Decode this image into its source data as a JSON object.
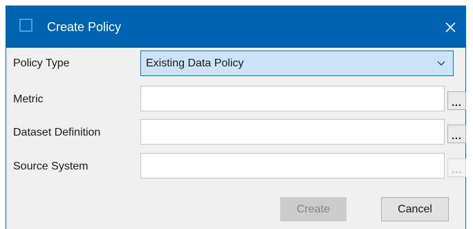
{
  "dialog": {
    "title": "Create Policy",
    "close_icon": "close-icon",
    "accent_color": "#0063b1"
  },
  "form": {
    "policy_type": {
      "label": "Policy Type",
      "value": "Existing Data Policy",
      "icon": "chevron-down-icon"
    },
    "metric": {
      "label": "Metric",
      "value": "",
      "browse_label": "..."
    },
    "dataset_definition": {
      "label": "Dataset Definition",
      "value": "",
      "browse_label": "..."
    },
    "source_system": {
      "label": "Source System",
      "value": "",
      "browse_label": "..."
    }
  },
  "actions": {
    "create_label": "Create",
    "cancel_label": "Cancel"
  }
}
